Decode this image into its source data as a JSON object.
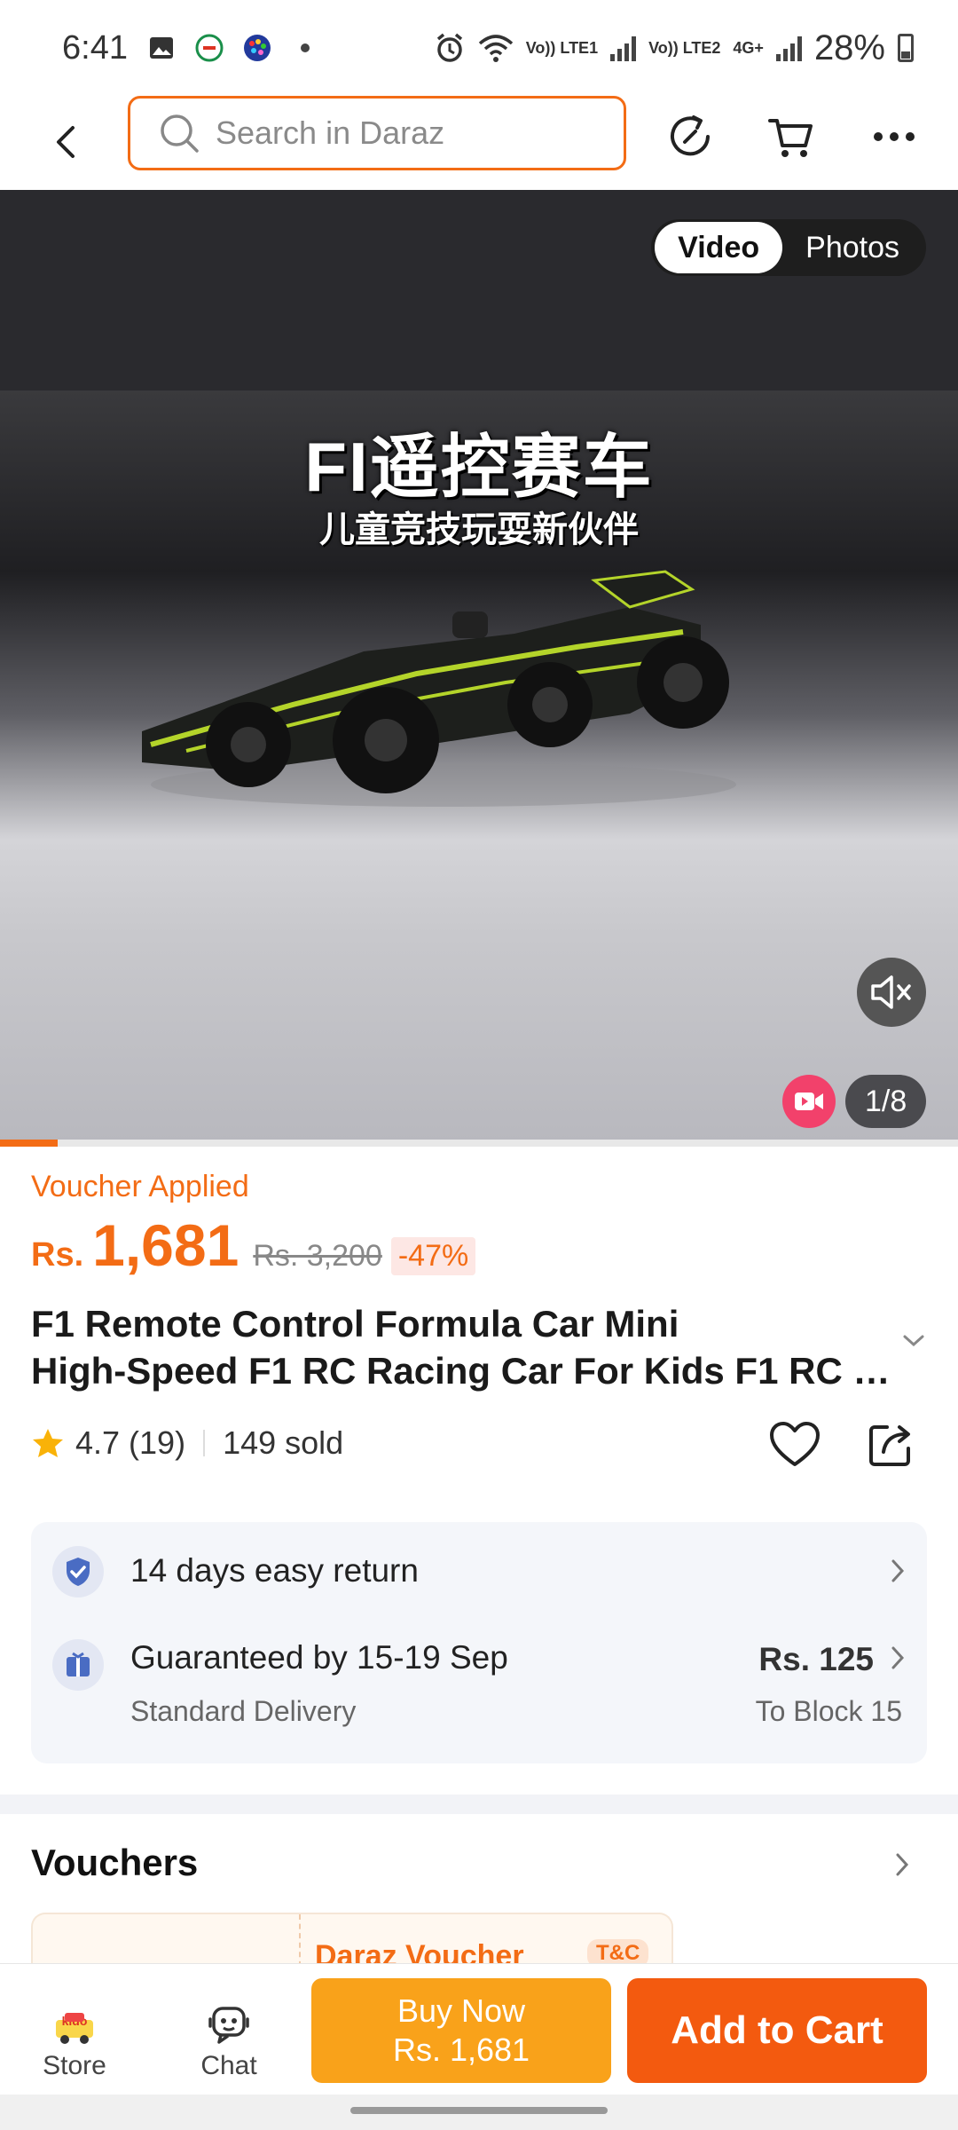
{
  "status_bar": {
    "time": "6:41",
    "sim1": "Vo)) LTE1",
    "sim2": "Vo)) LTE2",
    "net": "4G+",
    "battery_percent": "28%"
  },
  "header": {
    "search_placeholder": "Search in Daraz"
  },
  "media": {
    "toggle_video": "Video",
    "toggle_photos": "Photos",
    "overlay_title": "FI遥控赛车",
    "overlay_subtitle": "儿童竞技玩耍新伙伴",
    "page_counter": "1/8",
    "progress": 0.06
  },
  "product": {
    "voucher_applied": "Voucher Applied",
    "currency": "Rs.",
    "price": "1,681",
    "original_price": "Rs. 3,200",
    "discount": "-47%",
    "title_line1": "F1 Remote Control Formula Car Mini",
    "title_line2": "High-Speed F1 RC Racing Car For Kids F1 RC R...",
    "rating": "4.7 (19)",
    "sold": "149 sold"
  },
  "services": {
    "return_text": "14 days easy return",
    "delivery_title": "Guaranteed by 15-19 Sep",
    "delivery_sub": "Standard Delivery",
    "delivery_price": "Rs. 125",
    "delivery_location": "To Block 15"
  },
  "vouchers": {
    "section_title": "Vouchers",
    "card_title": "Daraz Voucher",
    "card_tc": "T&C"
  },
  "bottom_bar": {
    "store_label": "Store",
    "chat_label": "Chat",
    "buy_now_label": "Buy Now",
    "buy_now_price": "Rs. 1,681",
    "add_to_cart_label": "Add to Cart"
  },
  "colors": {
    "accent": "#f36c15",
    "buy_now": "#f9a21a",
    "add_to_cart": "#f35a0f"
  }
}
